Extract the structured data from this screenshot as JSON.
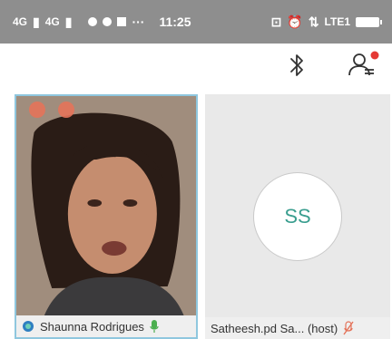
{
  "status_bar": {
    "signal1": "4G",
    "signal2": "4G",
    "time": "11:25",
    "dots": "···",
    "volte": "LTE1"
  },
  "participants": [
    {
      "name": "Shaunna Rodrigues",
      "initials": "",
      "mic": "on"
    },
    {
      "name": "Satheesh.pd Sa... (host)",
      "initials": "SS",
      "mic": "muted"
    }
  ],
  "colors": {
    "status_bar": "#8e8e8e",
    "accent_teal": "#3a9e8f",
    "active_border": "#8fc7de",
    "mic_green": "#4caf50",
    "mic_muted": "#e4735a",
    "notification_dot": "#e53935"
  },
  "icons": {
    "toolbar": [
      "bluetooth-icon",
      "participants-list-icon"
    ]
  }
}
